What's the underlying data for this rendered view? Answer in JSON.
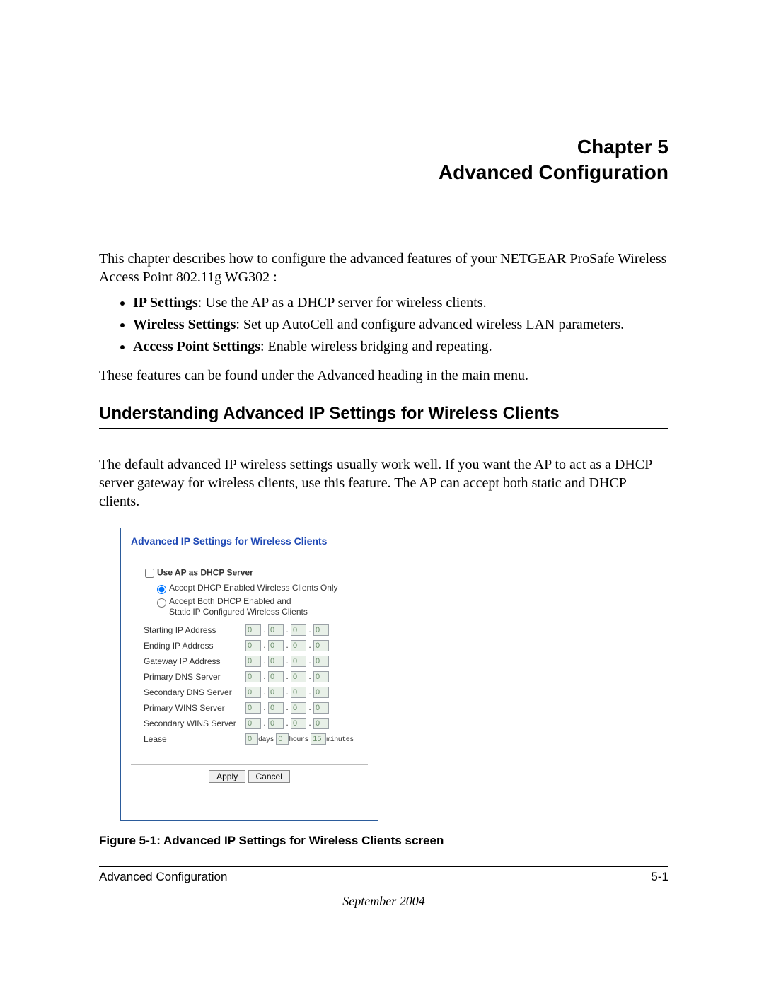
{
  "title": {
    "line1": "Chapter 5",
    "line2": "Advanced Configuration"
  },
  "intro": "This chapter describes how to configure the advanced features of your NETGEAR ProSafe Wireless Access Point 802.11g WG302 :",
  "bullets": [
    {
      "b": "IP Settings",
      "t": ": Use the AP as a DHCP server for wireless clients."
    },
    {
      "b": "Wireless Settings",
      "t": ": Set up AutoCell and configure advanced wireless LAN parameters."
    },
    {
      "b": "Access Point Settings",
      "t": ": Enable wireless bridging and repeating."
    }
  ],
  "outro": "These features can be found under the Advanced heading in the main menu.",
  "section_heading": "Understanding Advanced IP Settings for Wireless Clients",
  "section_para": "The default advanced IP wireless settings usually work well. If you want the AP to act as a DHCP server gateway for wireless clients, use this feature. The AP can accept both static and DHCP clients.",
  "panel": {
    "title": "Advanced IP Settings for Wireless Clients",
    "checkbox_label": "Use AP as DHCP Server",
    "radio1": "Accept DHCP Enabled Wireless Clients Only",
    "radio2a": "Accept Both DHCP Enabled and",
    "radio2b": "Static IP Configured Wireless Clients",
    "fields": [
      "Starting IP Address",
      "Ending IP Address",
      "Gateway IP Address",
      "Primary DNS Server",
      "Secondary DNS Server",
      "Primary WINS Server",
      "Secondary WINS Server"
    ],
    "octet": "0",
    "lease_label": "Lease",
    "lease": {
      "days": "0",
      "days_u": "days",
      "hours": "0",
      "hours_u": "hours",
      "mins": "15",
      "mins_u": "minutes"
    },
    "apply": "Apply",
    "cancel": "Cancel"
  },
  "caption": "Figure 5-1: Advanced IP Settings for Wireless Clients screen",
  "footer": {
    "left": "Advanced Configuration",
    "right": "5-1",
    "date": "September 2004"
  }
}
